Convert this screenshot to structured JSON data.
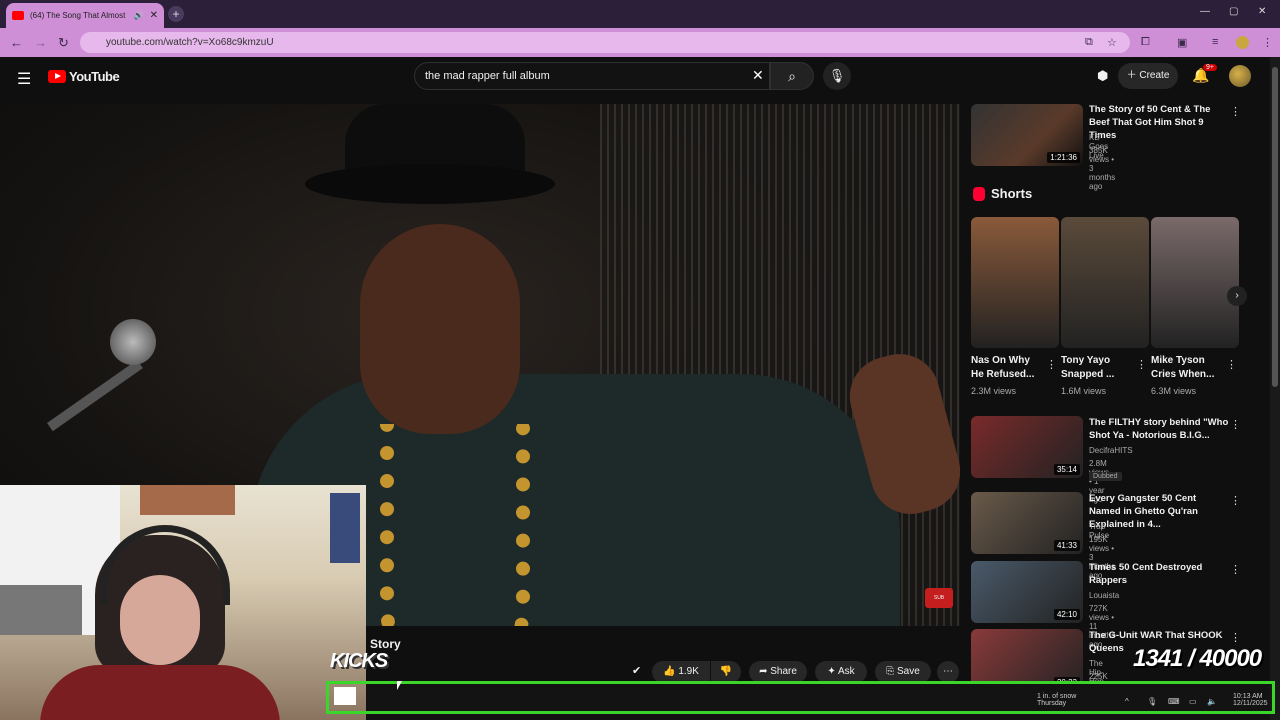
{
  "browser": {
    "tab_title": "(64) The Song That Almost",
    "url": "youtube.com/watch?v=Xo68c9kmzuU"
  },
  "header": {
    "logo_text": "YouTube",
    "search_value": "the mad rapper full album",
    "create_label": "Create",
    "notification_count": "9+"
  },
  "video": {
    "title_partial": "Story",
    "likes": "1.9K",
    "share_label": "Share",
    "ask_label": "Ask",
    "save_label": "Save"
  },
  "overlay": {
    "kicks_text": "KICKS",
    "counter_text": "1341  / 40000"
  },
  "sidebar": {
    "top_card": {
      "title": "The Story of 50 Cent & The Beef That Got Him Shot 9 Times",
      "channel": "KB Goes Live",
      "meta": "385K views • 3 months ago",
      "duration": "1:21:36"
    },
    "shorts_label": "Shorts",
    "shorts": [
      {
        "title": "Nas On Why He Refused...",
        "views": "2.3M views",
        "color": "#8a5a3a"
      },
      {
        "title": "Tony Yayo Snapped ...",
        "views": "1.6M views",
        "color": "#5a4a3a"
      },
      {
        "title": "Mike Tyson Cries When...",
        "views": "6.3M views",
        "color": "#7a6a6a"
      }
    ],
    "cards": [
      {
        "title": "The FILTHY story behind \"Who Shot Ya - Notorious B.I.G...",
        "channel": "DecifraHITS",
        "meta": "2.8M views • 1 year ago",
        "duration": "35:14",
        "badge": "Dubbed",
        "color": "#7a2a2a"
      },
      {
        "title": "Every Gangster 50 Cent Named in Ghetto Qu'ran Explained in 4...",
        "channel": "Trap Pulse",
        "meta": "195K views • 3 months ago",
        "duration": "41:33",
        "color": "#6a5a4a"
      },
      {
        "title": "Times 50 Cent Destroyed Rappers",
        "channel": "Louaista",
        "meta": "727K views • 11 months ago",
        "duration": "42:10",
        "color": "#4a5a6a"
      },
      {
        "title": "The G-Unit WAR That SHOOK Queens",
        "channel": "The Hip-Hop",
        "meta": "225K views • 2 months ago",
        "duration": "20:23",
        "color": "#8a3a3a"
      }
    ]
  },
  "taskbar": {
    "weather": "1 in. of snow",
    "weather_day": "Thursday",
    "time": "10:13 AM",
    "date": "12/11/2025"
  }
}
